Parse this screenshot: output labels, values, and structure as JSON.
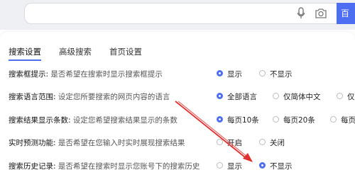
{
  "search": {
    "button_label": "百"
  },
  "tabs": [
    {
      "label": "搜索设置",
      "active": true
    },
    {
      "label": "高级搜索",
      "active": false
    },
    {
      "label": "首页设置",
      "active": false
    }
  ],
  "rows": [
    {
      "label": "搜索框提示:",
      "desc": "是否希望在搜索时显示搜索框提示",
      "options": [
        {
          "label": "显示",
          "checked": true
        },
        {
          "label": "不显示",
          "checked": false
        }
      ]
    },
    {
      "label": "搜索语言范围:",
      "desc": "设定您所要搜索的网页内容的语言",
      "options": [
        {
          "label": "全部语言",
          "checked": true
        },
        {
          "label": "仅简体中文",
          "checked": false
        },
        {
          "label": "仅",
          "checked": false
        }
      ]
    },
    {
      "label": "搜索结果显示条数:",
      "desc": "设定您希望搜索结果显示的条数",
      "options": [
        {
          "label": "每页10条",
          "checked": true
        },
        {
          "label": "每页20条",
          "checked": false
        },
        {
          "label": "每页",
          "checked": false
        }
      ]
    },
    {
      "label": "实时预测功能:",
      "desc": "是否希望在您输入时实时展现搜索结果",
      "options": [
        {
          "label": "开启",
          "checked": false
        },
        {
          "label": "关闭",
          "checked": false
        }
      ]
    },
    {
      "label": "搜索历史记录:",
      "desc": "是否希望在搜索时显示您账号下的搜索历史",
      "options": [
        {
          "label": "显示",
          "checked": false
        },
        {
          "label": "不显示",
          "checked": true
        }
      ]
    }
  ],
  "accent_color": "#4e6ef2",
  "annotation_color": "#e03030",
  "icons": [
    "microphone-icon",
    "camera-icon"
  ]
}
